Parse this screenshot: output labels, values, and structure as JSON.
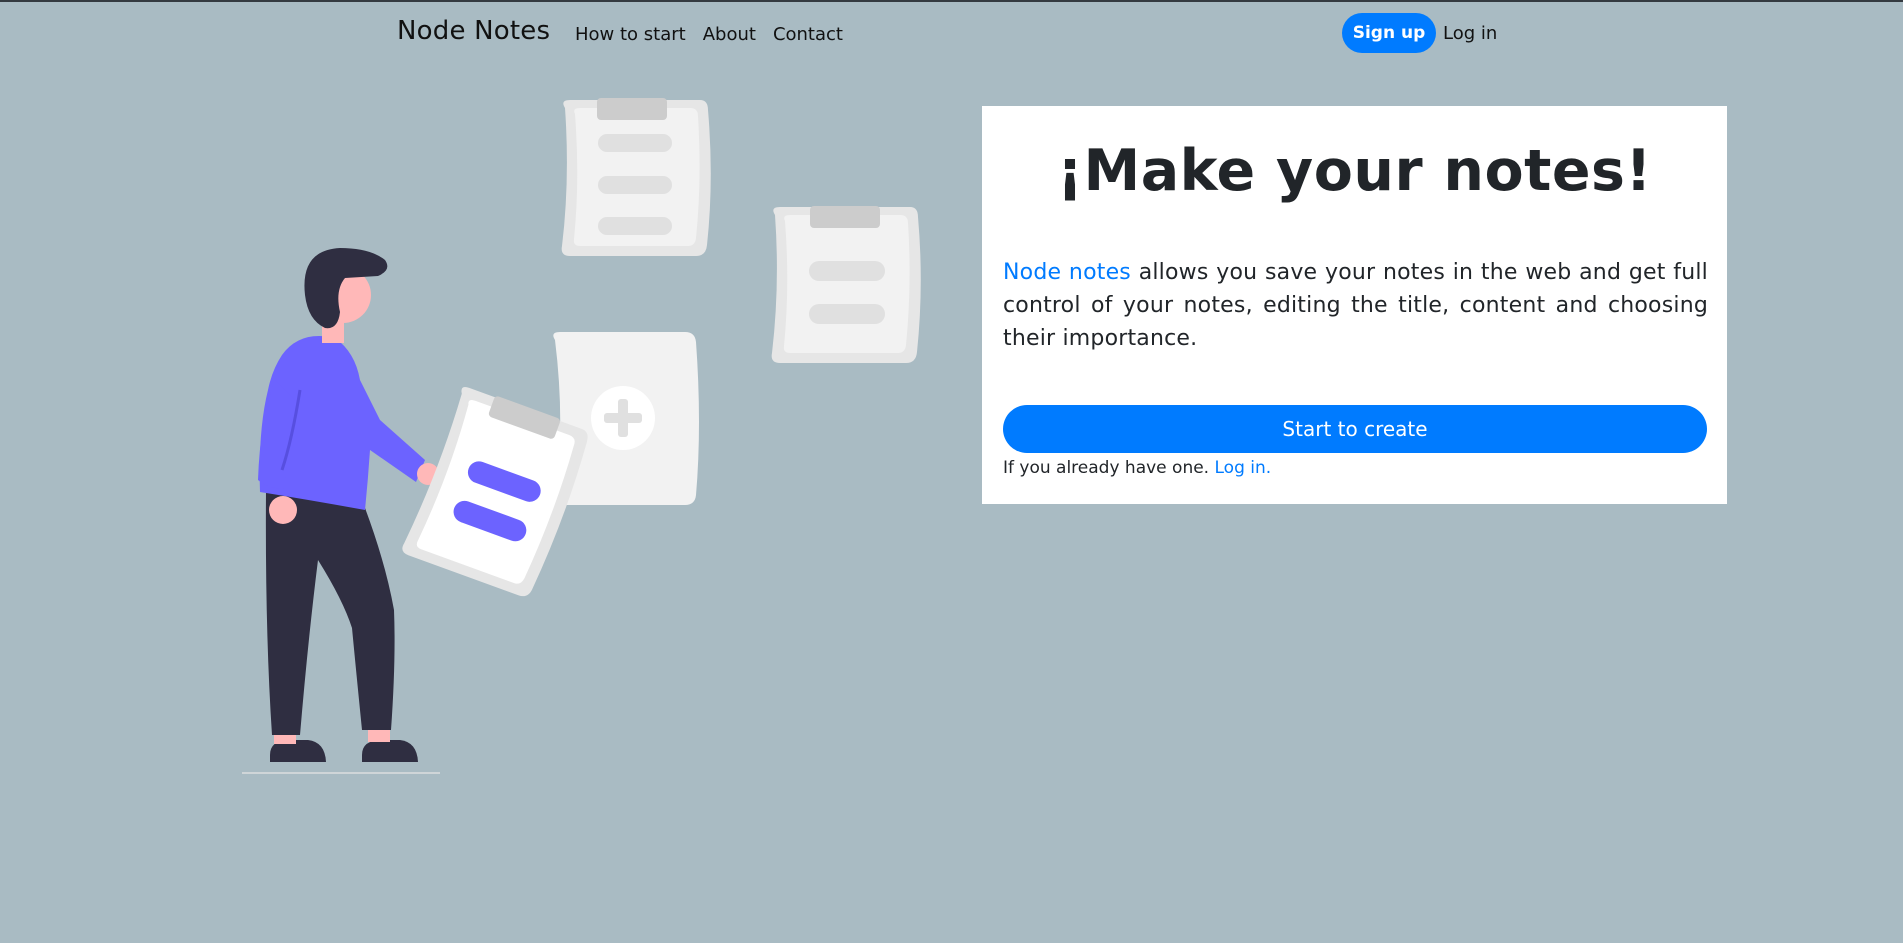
{
  "navbar": {
    "brand": "Node Notes",
    "links": [
      {
        "label": "How to start"
      },
      {
        "label": "About"
      },
      {
        "label": "Contact"
      }
    ],
    "signup_label": "Sign up",
    "login_label": "Log in"
  },
  "hero": {
    "title": "¡Make your notes!",
    "description_link": "Node notes",
    "description_rest": " allows you save your notes in the web and get full control of your notes, editing the title, content and choosing their importance.",
    "cta_label": "Start to create",
    "footer_prefix": "If you already have one. ",
    "footer_link": "Log in."
  },
  "colors": {
    "background": "#a9bbc3",
    "accent": "#007bff",
    "illustration_accent": "#6c63ff",
    "card": "#ffffff"
  }
}
